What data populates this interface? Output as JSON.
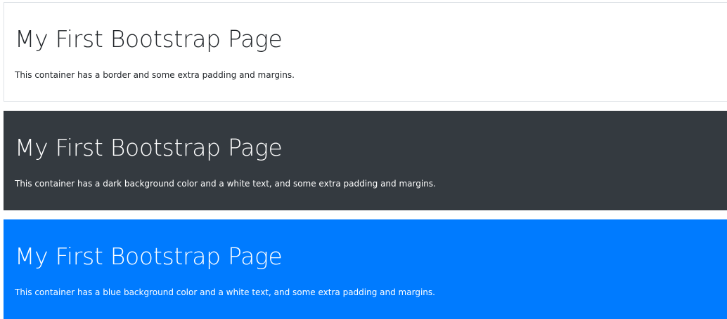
{
  "containers": [
    {
      "variant": "border",
      "background": "#ffffff",
      "text_color": "#212529",
      "title": "My First Bootstrap Page",
      "text": "This container has a border and some extra padding and margins."
    },
    {
      "variant": "dark",
      "background": "#343a40",
      "text_color": "#ffffff",
      "title": "My First Bootstrap Page",
      "text": "This container has a dark background color and a white text, and some extra padding and margins."
    },
    {
      "variant": "blue",
      "background": "#007bff",
      "text_color": "#ffffff",
      "title": "My First Bootstrap Page",
      "text": "This container has a blue background color and a white text, and some extra padding and margins."
    }
  ]
}
